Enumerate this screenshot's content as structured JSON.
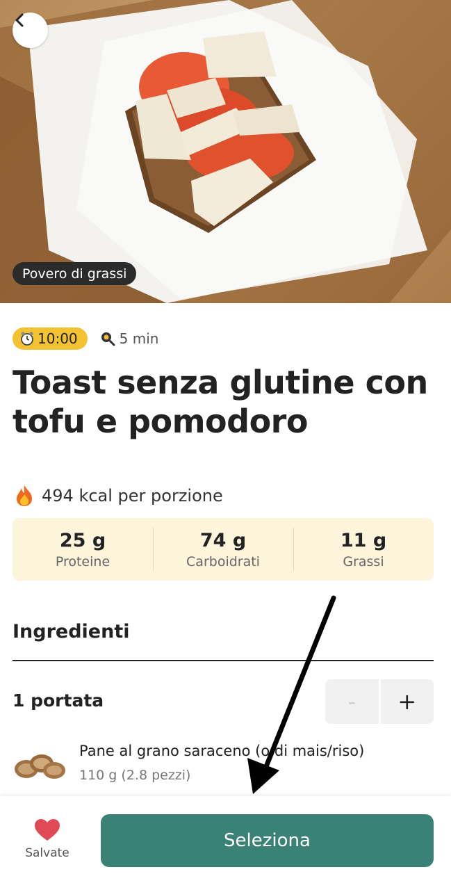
{
  "hero": {
    "badge": "Povero di grassi"
  },
  "meta": {
    "time": "10:00",
    "duration": "5 min"
  },
  "recipe": {
    "title": "Toast senza glutine con tofu e pomodoro",
    "kcal": "494 kcal per porzione"
  },
  "macros": [
    {
      "value": "25 g",
      "label": "Proteine"
    },
    {
      "value": "74 g",
      "label": "Carboidrati"
    },
    {
      "value": "11 g",
      "label": "Grassi"
    }
  ],
  "ingredients": {
    "section_title": "Ingredienti",
    "portion": "1 portata",
    "stepper": {
      "minus": "-",
      "plus": "+"
    },
    "items": [
      {
        "name": "Pane al grano saraceno (o di mais/riso)",
        "qty": "110 g (2.8 pezzi)"
      }
    ]
  },
  "bottom": {
    "save_label": "Salvate",
    "select_label": "Seleziona"
  },
  "colors": {
    "accent_green": "#3a8276",
    "time_pill": "#f2c233",
    "macro_bg": "#fdf4dc",
    "heart": "#e04a57"
  }
}
